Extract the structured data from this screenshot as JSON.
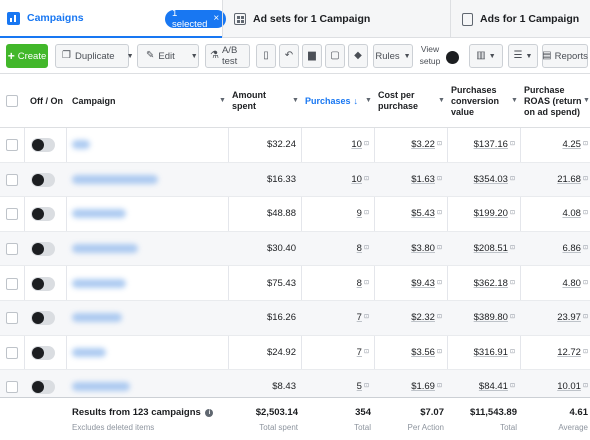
{
  "tabs": {
    "campaigns": {
      "label": "Campaigns",
      "chip": "1 selected",
      "chip_close": "×"
    },
    "adsets": {
      "label": "Ad sets for 1 Campaign"
    },
    "ads": {
      "label": "Ads for 1 Campaign"
    }
  },
  "toolbar": {
    "create": "Create",
    "duplicate": "Duplicate",
    "edit": "Edit",
    "ab_test": "A/B test",
    "rules": "Rules",
    "view_setup": "View setup",
    "reports": "Reports"
  },
  "table": {
    "headers": {
      "on_off": "Off / On",
      "campaign": "Campaign",
      "amount_spent": "Amount spent",
      "purchases": "Purchases",
      "cost_per_purchase": "Cost per purchase",
      "conversion_value": "Purchases conversion value",
      "roas": "Purchase ROAS (return on ad spend)"
    },
    "rows": [
      {
        "spent": "$32.24",
        "purchases": "10",
        "cost": "$3.22",
        "value": "$137.16",
        "roas": "4.25"
      },
      {
        "spent": "$16.33",
        "purchases": "10",
        "cost": "$1.63",
        "value": "$354.03",
        "roas": "21.68"
      },
      {
        "spent": "$48.88",
        "purchases": "9",
        "cost": "$5.43",
        "value": "$199.20",
        "roas": "4.08"
      },
      {
        "spent": "$30.40",
        "purchases": "8",
        "cost": "$3.80",
        "value": "$208.51",
        "roas": "6.86"
      },
      {
        "spent": "$75.43",
        "purchases": "8",
        "cost": "$9.43",
        "value": "$362.18",
        "roas": "4.80"
      },
      {
        "spent": "$16.26",
        "purchases": "7",
        "cost": "$2.32",
        "value": "$389.80",
        "roas": "23.97"
      },
      {
        "spent": "$24.92",
        "purchases": "7",
        "cost": "$3.56",
        "value": "$316.91",
        "roas": "12.72"
      },
      {
        "spent": "$8.43",
        "purchases": "5",
        "cost": "$1.69",
        "value": "$84.41",
        "roas": "10.01"
      }
    ],
    "footer": {
      "title": "Results from 123 campaigns",
      "subtitle": "Excludes deleted items",
      "spent": "$2,503.14",
      "spent_sub": "Total spent",
      "purchases": "354",
      "purchases_sub": "Total",
      "cost": "$7.07",
      "cost_sub": "Per Action",
      "value": "$11,543.89",
      "value_sub": "Total",
      "roas": "4.61",
      "roas_sub": "Average"
    }
  },
  "colors": {
    "accent": "#1877f2",
    "create": "#42b72a"
  }
}
